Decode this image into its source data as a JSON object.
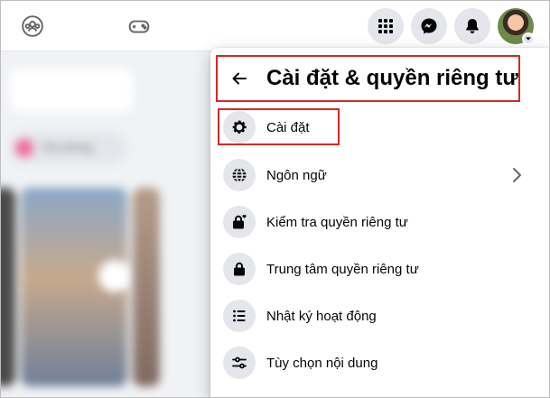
{
  "topbar": {
    "left_icons": [
      "groups-icon",
      "gaming-icon"
    ],
    "right_buttons": [
      "menu-grid-icon",
      "messenger-icon",
      "notifications-bell-icon"
    ],
    "avatar": "profile-avatar"
  },
  "background": {
    "blurred_text": "Tạo phòng"
  },
  "menu": {
    "header": {
      "back_icon": "arrow-left-icon",
      "title": "Cài đặt & quyền riêng tư"
    },
    "items": [
      {
        "label": "Cài đặt",
        "icon": "gear-icon",
        "has_chevron": false,
        "highlighted": true
      },
      {
        "label": "Ngôn ngữ",
        "icon": "globe-icon",
        "has_chevron": true,
        "highlighted": false
      },
      {
        "label": "Kiểm tra quyền riêng tư",
        "icon": "lock-heart-icon",
        "has_chevron": false,
        "highlighted": false
      },
      {
        "label": "Trung tâm quyền riêng tư",
        "icon": "lock-icon",
        "has_chevron": false,
        "highlighted": false
      },
      {
        "label": "Nhật ký hoạt động",
        "icon": "list-icon",
        "has_chevron": false,
        "highlighted": false
      },
      {
        "label": "Tùy chọn nội dung",
        "icon": "sliders-icon",
        "has_chevron": false,
        "highlighted": false
      }
    ]
  },
  "colors": {
    "highlight_red": "#d62828",
    "icon_bg": "#e4e6eb",
    "text": "#050505"
  }
}
